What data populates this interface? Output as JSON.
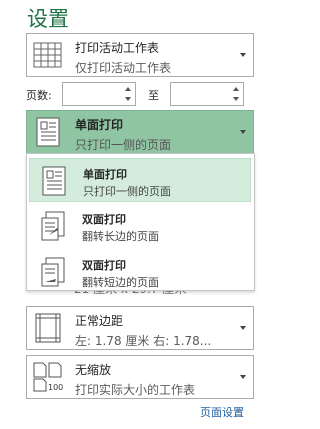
{
  "title": "设置",
  "print_scope": {
    "label": "打印活动工作表",
    "sublabel": "仅打印活动工作表",
    "icon": "sheet-icon"
  },
  "pages": {
    "label": "页数:",
    "from_value": "",
    "to_label": "至",
    "to_value": ""
  },
  "sides": {
    "label": "单面打印",
    "sublabel": "只打印一侧的页面",
    "icon": "single-side-icon",
    "options": [
      {
        "label": "单面打印",
        "sublabel": "只打印一侧的页面",
        "icon": "single-side-icon",
        "selected": true
      },
      {
        "label": "双面打印",
        "sublabel": "翻转长边的页面",
        "icon": "duplex-long-edge-icon",
        "selected": false
      },
      {
        "label": "双面打印",
        "sublabel": "翻转短边的页面",
        "icon": "duplex-short-edge-icon",
        "selected": false
      }
    ]
  },
  "paper_partial": "21 厘米 x 29.7 厘米",
  "margins": {
    "label": "正常边距",
    "sublabel": "左: 1.78 厘米    右: 1.78...",
    "icon": "margins-icon"
  },
  "scaling": {
    "label": "无缩放",
    "sublabel": "打印实际大小的工作表",
    "icon": "scale-100-icon"
  },
  "page_setup_link": "页面设置",
  "colors": {
    "accent": "#217346",
    "selected_dropdown": "#8fc5a3",
    "selected_option": "#d3ecdc",
    "link": "#1e5d9e"
  }
}
